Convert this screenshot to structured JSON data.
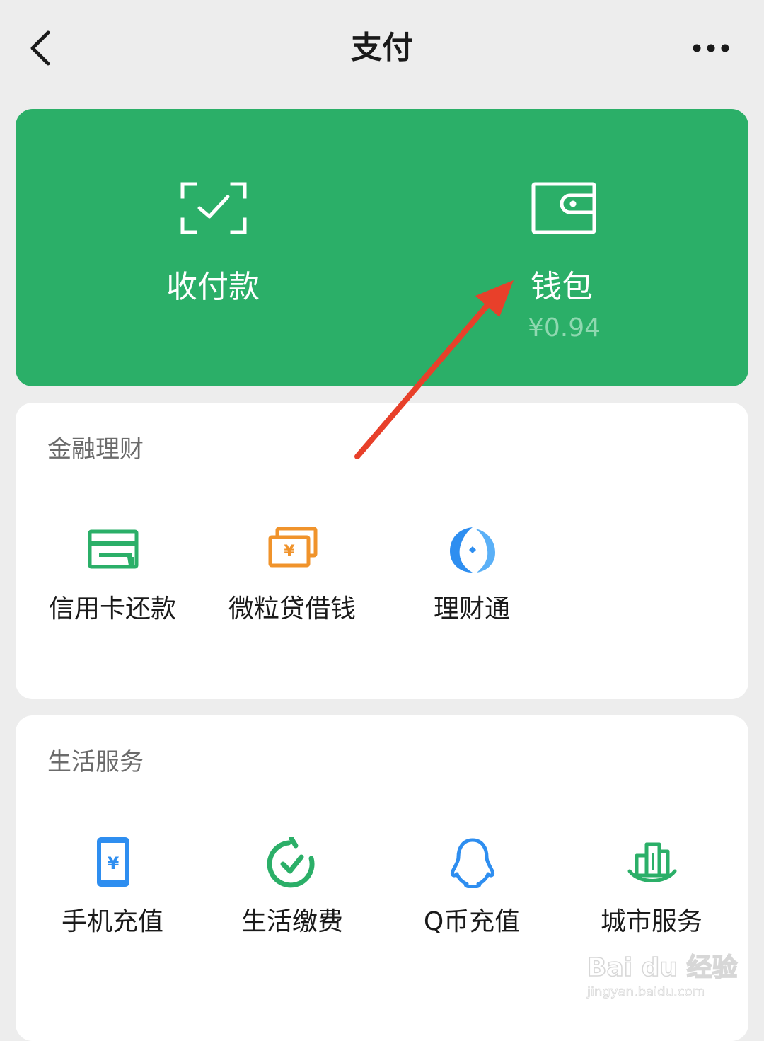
{
  "header": {
    "title": "支付",
    "back_icon": "chevron-left-icon",
    "more_icon": "more-dots-icon"
  },
  "wallet_card": {
    "background": "#2baf68",
    "pay": {
      "label": "收付款",
      "icon": "scan-check-icon"
    },
    "wallet": {
      "label": "钱包",
      "balance": "¥0.94",
      "icon": "wallet-icon"
    }
  },
  "finance": {
    "title": "金融理财",
    "items": [
      {
        "label": "信用卡还款",
        "icon": "credit-card-icon",
        "color": "#2baf68"
      },
      {
        "label": "微粒贷借钱",
        "icon": "loan-cash-icon",
        "color": "#f0932b"
      },
      {
        "label": "理财通",
        "icon": "licaitong-icon",
        "color": "#2e8ef0"
      }
    ]
  },
  "life": {
    "title": "生活服务",
    "items": [
      {
        "label": "手机充值",
        "icon": "phone-recharge-icon",
        "color": "#2e8ef0"
      },
      {
        "label": "生活缴费",
        "icon": "utility-bill-icon",
        "color": "#2baf68"
      },
      {
        "label": "Q币充值",
        "icon": "qq-coin-icon",
        "color": "#2e8ef0"
      },
      {
        "label": "城市服务",
        "icon": "city-service-icon",
        "color": "#2baf68"
      }
    ]
  },
  "annotation": {
    "arrow_color": "#e8402a"
  },
  "watermark": {
    "line1": "Bai du 经验",
    "line2": "jingyan.baidu.com"
  }
}
